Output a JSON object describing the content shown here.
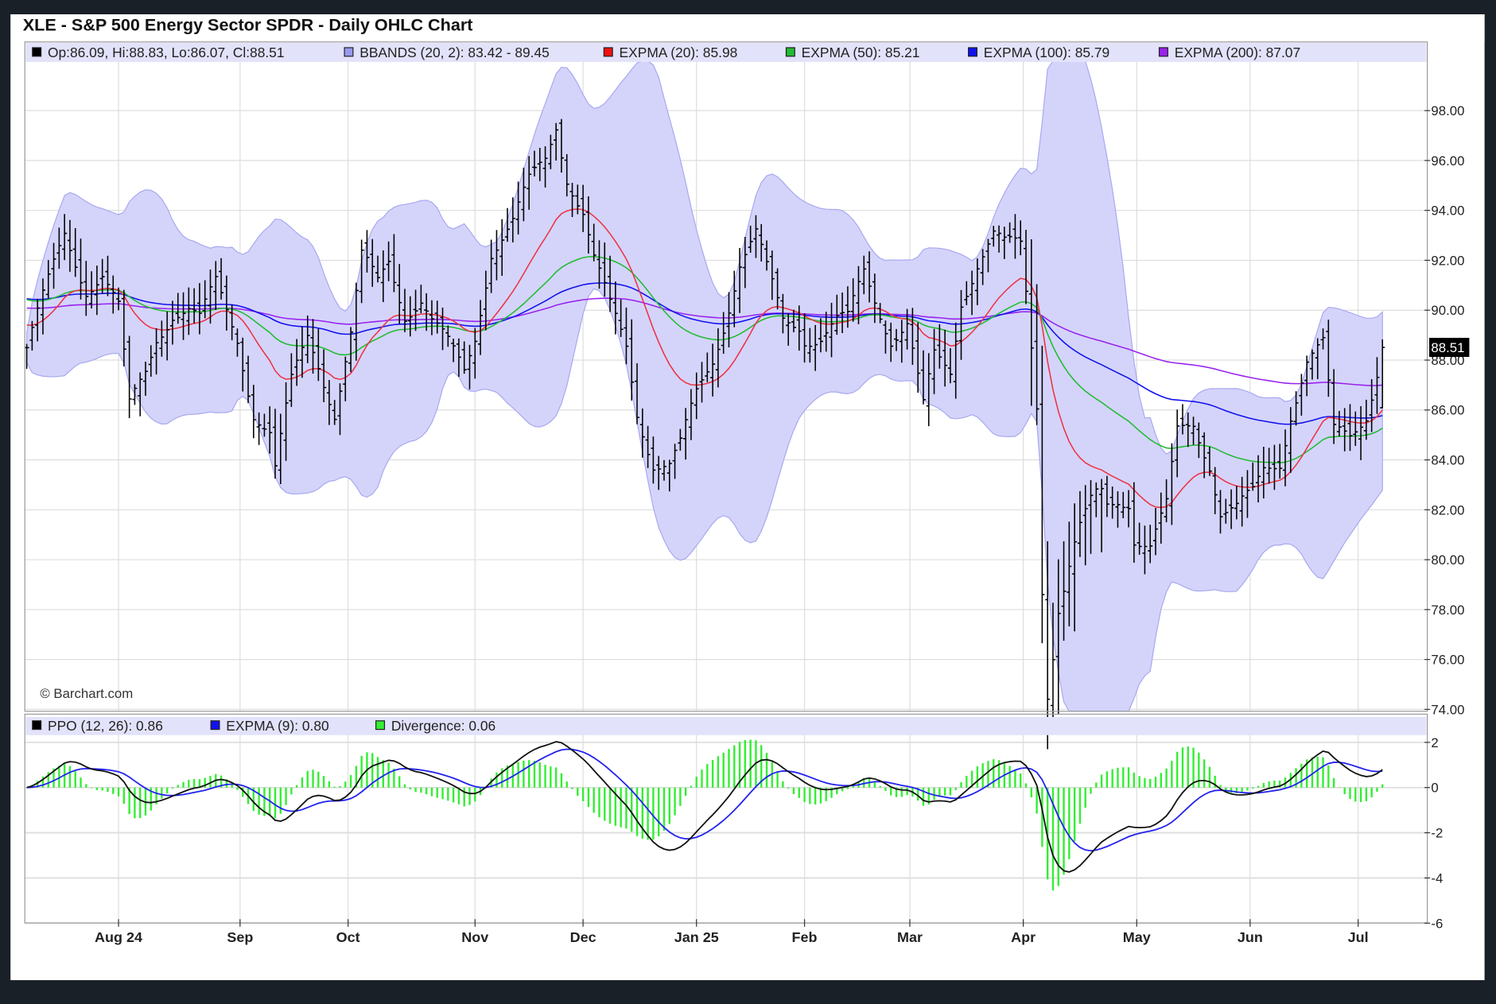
{
  "chart_data": {
    "type": "ohlc",
    "title": "XLE - S&P 500 Energy Sector SPDR - Daily OHLC Chart",
    "watermark": "© Barchart.com",
    "legend_main": [
      {
        "label": "Op:86.09, Hi:88.83, Lo:86.07, Cl:88.51",
        "color": "#000000"
      },
      {
        "label": "BBANDS (20, 2): 83.42 - 89.45",
        "color": "#9999ee"
      },
      {
        "label": "EXPMA (20): 85.98",
        "color": "#ee1111"
      },
      {
        "label": "EXPMA (50): 85.21",
        "color": "#22bb33"
      },
      {
        "label": "EXPMA (100): 85.79",
        "color": "#1111ee"
      },
      {
        "label": "EXPMA (200): 87.07",
        "color": "#9922ee"
      }
    ],
    "legend_ppo": [
      {
        "label": "PPO (12, 26): 0.86",
        "color": "#000000"
      },
      {
        "label": "EXPMA (9): 0.80",
        "color": "#1111ee"
      },
      {
        "label": "Divergence: 0.06",
        "color": "#33ee33"
      }
    ],
    "last_price": "88.51",
    "y_ticks": [
      "74.00",
      "76.00",
      "78.00",
      "80.00",
      "82.00",
      "84.00",
      "86.00",
      "88.00",
      "90.00",
      "92.00",
      "94.00",
      "96.00",
      "98.00"
    ],
    "ylim": [
      74,
      98
    ],
    "ppo_ticks": [
      "2",
      "0",
      "-2",
      "-4",
      "-6"
    ],
    "ppo_ylim": [
      -6,
      2
    ],
    "n_bars": 252,
    "x_ticks": [
      {
        "label": "Aug 24",
        "idx": 17
      },
      {
        "label": "Sep",
        "idx": 39.5
      },
      {
        "label": "Oct",
        "idx": 59.5
      },
      {
        "label": "Nov",
        "idx": 83
      },
      {
        "label": "Dec",
        "idx": 103
      },
      {
        "label": "Jan 25",
        "idx": 124
      },
      {
        "label": "Feb",
        "idx": 144
      },
      {
        "label": "Mar",
        "idx": 163.5
      },
      {
        "label": "Apr",
        "idx": 184.5
      },
      {
        "label": "May",
        "idx": 205.5
      },
      {
        "label": "Jun",
        "idx": 226.5
      },
      {
        "label": "Jul",
        "idx": 246.5
      }
    ],
    "close_knots": [
      [
        0,
        88.5
      ],
      [
        4,
        91
      ],
      [
        7,
        93
      ],
      [
        11,
        91
      ],
      [
        14,
        91.5
      ],
      [
        17,
        90
      ],
      [
        19,
        86
      ],
      [
        22,
        87.5
      ],
      [
        24,
        89
      ],
      [
        27,
        90
      ],
      [
        30,
        90
      ],
      [
        32,
        89.5
      ],
      [
        35,
        91
      ],
      [
        37,
        90
      ],
      [
        39,
        89
      ],
      [
        42,
        86
      ],
      [
        45,
        85
      ],
      [
        46,
        83.5
      ],
      [
        49,
        87
      ],
      [
        52,
        89
      ],
      [
        54,
        88
      ],
      [
        57,
        86
      ],
      [
        60,
        89
      ],
      [
        62,
        92
      ],
      [
        65,
        91
      ],
      [
        67,
        92
      ],
      [
        70,
        90
      ],
      [
        73,
        90.5
      ],
      [
        75,
        89.5
      ],
      [
        78,
        88.5
      ],
      [
        81,
        87.5
      ],
      [
        83,
        89
      ],
      [
        86,
        92.5
      ],
      [
        90,
        93.5
      ],
      [
        93,
        95
      ],
      [
        96,
        96
      ],
      [
        98,
        97.5
      ],
      [
        100,
        95.5
      ],
      [
        103,
        94
      ],
      [
        105,
        92
      ],
      [
        108,
        90
      ],
      [
        111,
        88.5
      ],
      [
        113,
        86
      ],
      [
        116,
        84
      ],
      [
        119,
        83.8
      ],
      [
        121,
        84.5
      ],
      [
        124,
        86.5
      ],
      [
        127,
        88
      ],
      [
        129,
        89.5
      ],
      [
        132,
        92
      ],
      [
        135,
        93
      ],
      [
        137,
        91.5
      ],
      [
        140,
        89.5
      ],
      [
        143,
        89.5
      ],
      [
        144,
        89
      ],
      [
        147,
        89
      ],
      [
        150,
        89.5
      ],
      [
        152,
        89.5
      ],
      [
        155,
        91.5
      ],
      [
        158,
        90
      ],
      [
        160,
        89
      ],
      [
        163,
        89.5
      ],
      [
        166,
        86
      ],
      [
        168,
        88
      ],
      [
        171,
        87.5
      ],
      [
        173,
        90.5
      ],
      [
        176,
        92
      ],
      [
        179,
        93
      ],
      [
        181,
        92.5
      ],
      [
        184,
        92.5
      ],
      [
        187,
        87
      ],
      [
        188,
        80
      ],
      [
        189,
        76
      ],
      [
        191,
        79
      ],
      [
        194,
        80
      ],
      [
        196,
        80.5
      ],
      [
        199,
        82
      ],
      [
        202,
        82.5
      ],
      [
        204,
        82.5
      ],
      [
        205,
        81
      ],
      [
        208,
        80.5
      ],
      [
        211,
        82
      ],
      [
        213,
        85
      ],
      [
        216,
        85.5
      ],
      [
        219,
        84
      ],
      [
        221,
        82
      ],
      [
        224,
        82
      ],
      [
        227,
        82.5
      ],
      [
        229,
        83.5
      ],
      [
        232,
        84
      ],
      [
        234,
        86
      ],
      [
        237,
        88
      ],
      [
        240,
        88.5
      ],
      [
        242,
        85
      ],
      [
        245,
        85
      ],
      [
        248,
        86
      ],
      [
        251,
        88.51
      ]
    ]
  }
}
